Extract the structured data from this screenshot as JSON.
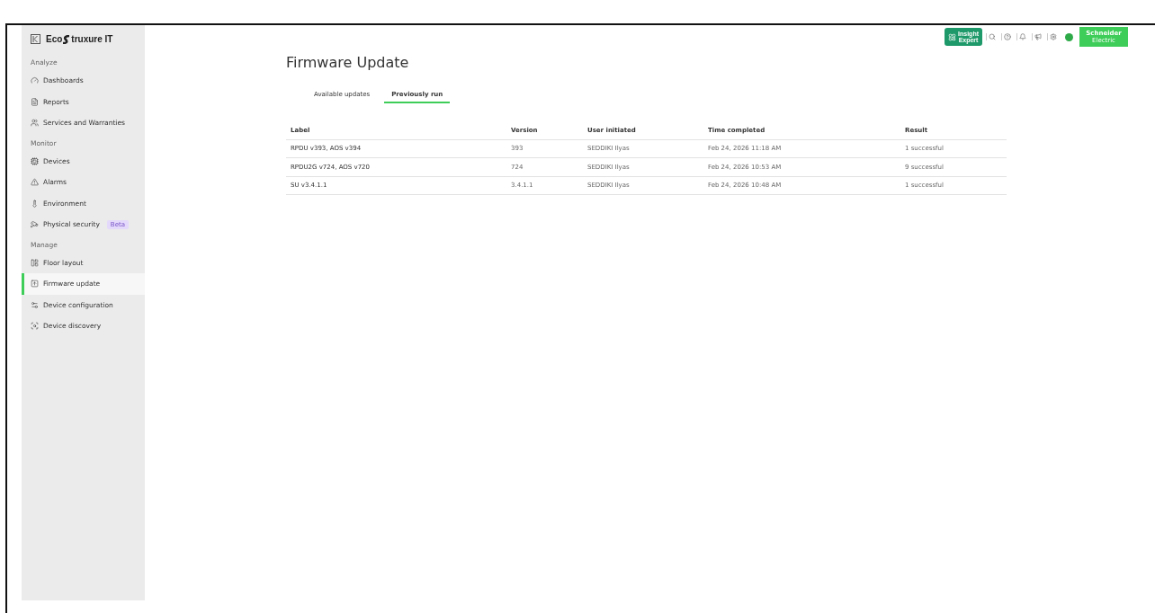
{
  "brand": {
    "before": "Eco",
    "after": "truxure IT"
  },
  "sidebar": {
    "sections": [
      {
        "heading": "Analyze",
        "items": [
          {
            "kind": "dashboards",
            "label": "Dashboards",
            "selected": false
          },
          {
            "kind": "reports",
            "label": "Reports",
            "selected": false
          },
          {
            "kind": "services",
            "label": "Services and Warranties",
            "selected": false
          }
        ]
      },
      {
        "heading": "Monitor",
        "items": [
          {
            "kind": "devices",
            "label": "Devices",
            "selected": false
          },
          {
            "kind": "alarms",
            "label": "Alarms",
            "selected": false
          },
          {
            "kind": "environment",
            "label": "Environment",
            "selected": false
          },
          {
            "kind": "security",
            "label": "Physical security",
            "badge": "Beta",
            "selected": false
          }
        ]
      },
      {
        "heading": "Manage",
        "items": [
          {
            "kind": "floor",
            "label": "Floor layout",
            "selected": false
          },
          {
            "kind": "firmware",
            "label": "Firmware update",
            "selected": true
          },
          {
            "kind": "config",
            "label": "Device configuration",
            "selected": false
          },
          {
            "kind": "discovery",
            "label": "Device discovery",
            "selected": false
          }
        ]
      }
    ]
  },
  "topbar": {
    "insight": [
      "Insight",
      "Expert"
    ],
    "company": {
      "name": "Schneider",
      "sub": "Electric"
    }
  },
  "page": {
    "title": "Firmware Update"
  },
  "tabs": [
    {
      "label": "Available updates",
      "selected": false
    },
    {
      "label": "Previously run",
      "selected": true
    }
  ],
  "table": {
    "columns": [
      "Label",
      "Version",
      "User initiated",
      "Time completed",
      "Result"
    ],
    "rows": [
      [
        "RPDU v393, AOS v394",
        "393",
        "SEDDIKI Ilyas",
        "Feb 24, 2026 11:18 AM",
        "1 successful"
      ],
      [
        "RPDU2G v724, AOS v720",
        "724",
        "SEDDIKI Ilyas",
        "Feb 24, 2026 10:53 AM",
        "9 successful"
      ],
      [
        "SU v3.4.1.1",
        "3.4.1.1",
        "SEDDIKI Ilyas",
        "Feb 24, 2026 10:48 AM",
        "1 successful"
      ]
    ]
  }
}
